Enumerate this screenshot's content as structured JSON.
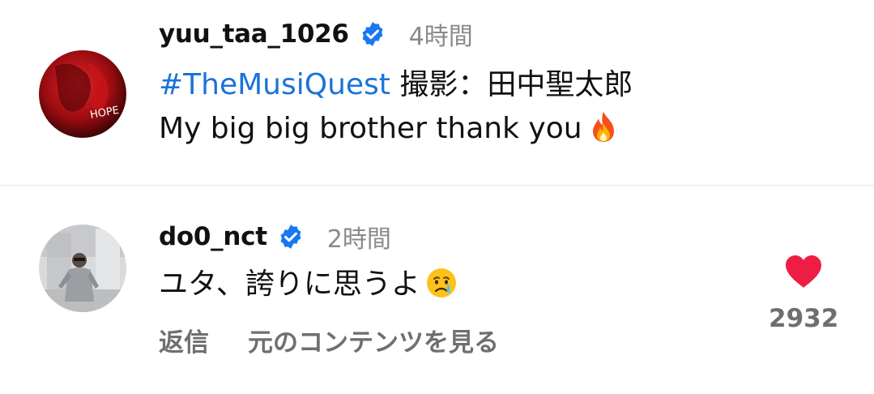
{
  "comments": [
    {
      "username": "yuu_taa_1026",
      "verified": true,
      "timestamp": "4時間",
      "line1_hashtag": "#TheMusiQuest",
      "line1_text": " 撮影：田中聖太郎",
      "line2_text": "My big big brother thank you",
      "emoji": "fire-icon"
    },
    {
      "username": "do0_nct",
      "verified": true,
      "timestamp": "2時間",
      "text": "ユタ、誇りに思うよ",
      "emoji": "crying-face-icon",
      "reply_label": "返信",
      "view_original_label": "元のコンテンツを見る",
      "like_count": "2932"
    }
  ],
  "colors": {
    "hashtag": "#1a73d9",
    "verified": "#1877f2",
    "heart": "#ee1d43",
    "secondary_text": "#8a8a8a"
  }
}
